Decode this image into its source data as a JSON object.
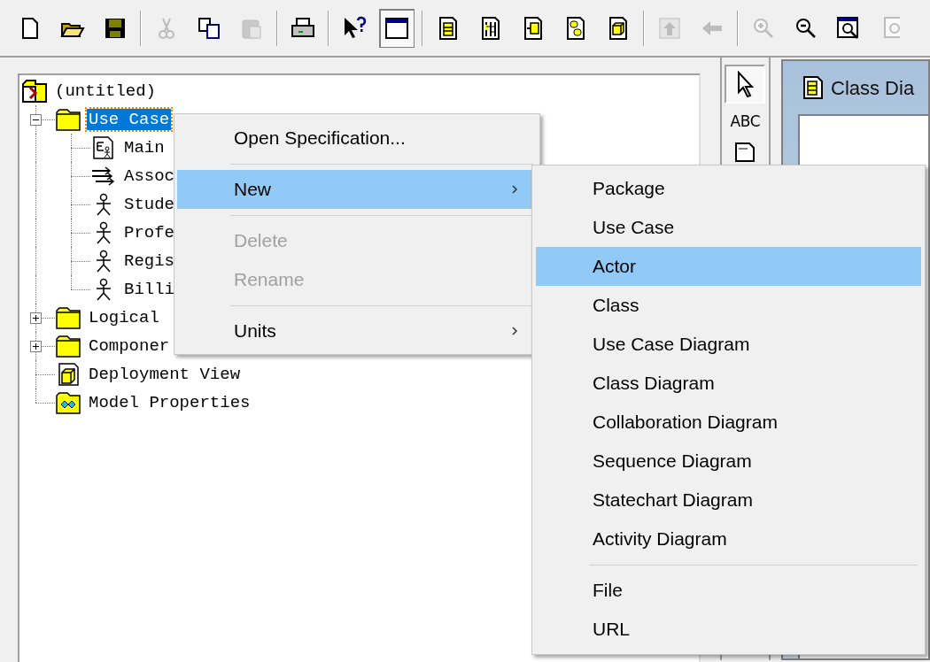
{
  "toolbar": [
    {
      "kind": "new",
      "disabled": false,
      "pressed": false
    },
    {
      "kind": "open",
      "disabled": false,
      "pressed": false
    },
    {
      "kind": "save",
      "disabled": false,
      "pressed": false
    },
    {
      "kind": "separator"
    },
    {
      "kind": "cut",
      "disabled": true,
      "pressed": false
    },
    {
      "kind": "copy",
      "disabled": false,
      "pressed": false
    },
    {
      "kind": "paste",
      "disabled": true,
      "pressed": false
    },
    {
      "kind": "separator"
    },
    {
      "kind": "print",
      "disabled": false,
      "pressed": false
    },
    {
      "kind": "separator"
    },
    {
      "kind": "help",
      "disabled": false,
      "pressed": false
    },
    {
      "kind": "window",
      "disabled": false,
      "pressed": true
    },
    {
      "kind": "separator"
    },
    {
      "kind": "class-diagram",
      "disabled": false,
      "pressed": false
    },
    {
      "kind": "sequence-diagram",
      "disabled": false,
      "pressed": false
    },
    {
      "kind": "collaboration-diagram",
      "disabled": false,
      "pressed": false
    },
    {
      "kind": "statechart-diagram",
      "disabled": false,
      "pressed": false
    },
    {
      "kind": "deployment-diagram",
      "disabled": false,
      "pressed": false
    },
    {
      "kind": "separator"
    },
    {
      "kind": "parent",
      "disabled": true,
      "pressed": false
    },
    {
      "kind": "back",
      "disabled": true,
      "pressed": false
    },
    {
      "kind": "separator"
    },
    {
      "kind": "zoom-in",
      "disabled": true,
      "pressed": false
    },
    {
      "kind": "zoom-out",
      "disabled": false,
      "pressed": false
    },
    {
      "kind": "fit",
      "disabled": false,
      "pressed": false
    },
    {
      "kind": "fit-selection",
      "disabled": true,
      "pressed": false
    }
  ],
  "tree": {
    "label": "(untitled)",
    "kind": "root",
    "selected": false,
    "children": [
      {
        "label": "Use Case",
        "kind": "folder",
        "selected": true,
        "expanded": true,
        "children": [
          {
            "label": "Main",
            "kind": "diagram",
            "selected": false
          },
          {
            "label": "Assoc",
            "kind": "association",
            "selected": false
          },
          {
            "label": "Stude",
            "kind": "actor",
            "selected": false
          },
          {
            "label": "Profe",
            "kind": "actor",
            "selected": false
          },
          {
            "label": "Regis",
            "kind": "actor",
            "selected": false
          },
          {
            "label": "Billi",
            "kind": "actor",
            "selected": false
          }
        ]
      },
      {
        "label": "Logical",
        "kind": "folder",
        "selected": false,
        "expanded": false
      },
      {
        "label": "Componer",
        "kind": "folder",
        "selected": false,
        "expanded": false
      },
      {
        "label": "Deployment View",
        "kind": "deployment",
        "selected": false
      },
      {
        "label": "Model Properties",
        "kind": "properties",
        "selected": false
      }
    ]
  },
  "toolbox": {
    "pointer_pressed": true,
    "text_tool": "ABC"
  },
  "diagram_window": {
    "title": "Class Dia"
  },
  "context_menu": [
    {
      "kind": "item",
      "label": "Open Specification...",
      "selected": false,
      "disabled": false,
      "submenu": false
    },
    {
      "kind": "separator"
    },
    {
      "kind": "item",
      "label": "New",
      "selected": true,
      "disabled": false,
      "submenu": true
    },
    {
      "kind": "separator"
    },
    {
      "kind": "item",
      "label": "Delete",
      "selected": false,
      "disabled": true,
      "submenu": false
    },
    {
      "kind": "item",
      "label": "Rename",
      "selected": false,
      "disabled": true,
      "submenu": false
    },
    {
      "kind": "separator"
    },
    {
      "kind": "item",
      "label": "Units",
      "selected": false,
      "disabled": false,
      "submenu": true
    }
  ],
  "submenu": [
    {
      "kind": "item",
      "label": "Package",
      "selected": false
    },
    {
      "kind": "item",
      "label": "Use Case",
      "selected": false
    },
    {
      "kind": "item",
      "label": "Actor",
      "selected": true
    },
    {
      "kind": "item",
      "label": "Class",
      "selected": false
    },
    {
      "kind": "item",
      "label": "Use Case Diagram",
      "selected": false
    },
    {
      "kind": "item",
      "label": "Class Diagram",
      "selected": false
    },
    {
      "kind": "item",
      "label": "Collaboration Diagram",
      "selected": false
    },
    {
      "kind": "item",
      "label": "Sequence Diagram",
      "selected": false
    },
    {
      "kind": "item",
      "label": "Statechart Diagram",
      "selected": false
    },
    {
      "kind": "item",
      "label": "Activity Diagram",
      "selected": false
    },
    {
      "kind": "separator"
    },
    {
      "kind": "item",
      "label": "File",
      "selected": false
    },
    {
      "kind": "item",
      "label": "URL",
      "selected": false
    }
  ]
}
